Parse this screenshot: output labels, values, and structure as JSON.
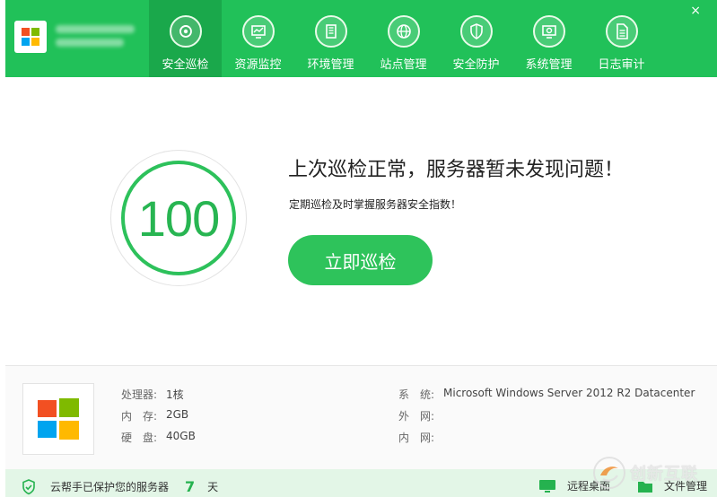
{
  "header": {
    "server_name_line1": "",
    "server_name_line2": "",
    "close_label": "×",
    "nav": [
      {
        "label": "安全巡检",
        "icon": "scan-eye-icon",
        "active": true
      },
      {
        "label": "资源监控",
        "icon": "monitor-chart-icon",
        "active": false
      },
      {
        "label": "环境管理",
        "icon": "building-icon",
        "active": false
      },
      {
        "label": "站点管理",
        "icon": "globe-icon",
        "active": false
      },
      {
        "label": "安全防护",
        "icon": "shield-icon",
        "active": false
      },
      {
        "label": "系统管理",
        "icon": "system-gear-icon",
        "active": false
      },
      {
        "label": "日志审计",
        "icon": "document-icon",
        "active": false
      }
    ]
  },
  "main": {
    "score": "100",
    "status_title": "上次巡检正常，服务器暂未发现问题！",
    "status_subtitle": "定期巡检及时掌握服务器安全指数！",
    "scan_button": "立即巡检"
  },
  "specs": {
    "cpu": {
      "label": "处理器:",
      "value": "1核"
    },
    "memory": {
      "label": "内　存:",
      "value": "2GB"
    },
    "disk": {
      "label": "硬　盘:",
      "value": "40GB"
    },
    "system": {
      "label": "系　统:",
      "value": "Microsoft Windows Server 2012 R2 Datacenter"
    },
    "public_ip": {
      "label": "外　网:",
      "value": ""
    },
    "private_ip": {
      "label": "内　网:",
      "value": ""
    }
  },
  "footer": {
    "protect_text": "云帮手已保护您的服务器",
    "days": "7",
    "days_unit": "天",
    "remote_desktop": "远程桌面",
    "file_manager": "文件管理"
  },
  "watermark": {
    "text": "创新互联"
  },
  "colors": {
    "brand_green": "#21c159",
    "active_tab": "#1aa84b",
    "score_green": "#2dc15b",
    "footer_bg": "#e3f6e7"
  }
}
